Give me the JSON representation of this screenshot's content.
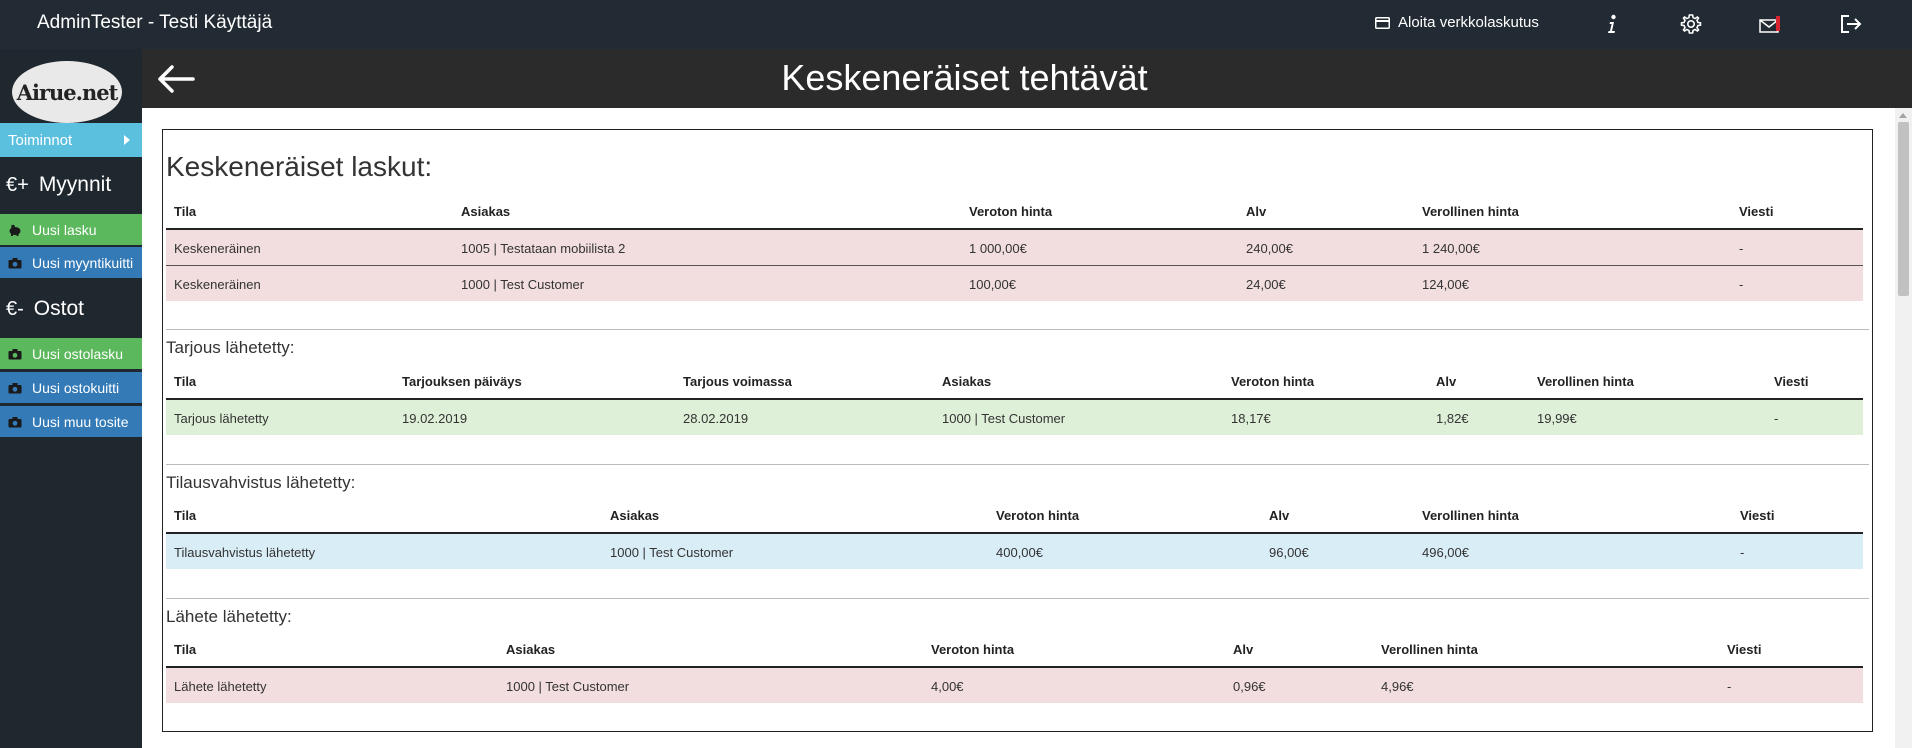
{
  "topbar": {
    "user": "AdminTester - Testi Käyttäjä",
    "einvoice_label": "Aloita verkkolaskutus",
    "icons": [
      "info-icon",
      "gear-icon",
      "mail-icon",
      "logout-icon"
    ]
  },
  "sidebar": {
    "logo": "Airue.net",
    "menu_label": "Toiminnot",
    "sales": {
      "heading_symbol": "€+",
      "heading": "Myynnit",
      "items": [
        {
          "label": "Uusi lasku",
          "color": "#5cb85c",
          "icon": "piggy-bank-icon"
        },
        {
          "label": "Uusi myyntikuitti",
          "color": "#337ab7",
          "icon": "camera-icon"
        }
      ]
    },
    "purchases": {
      "heading_symbol": "€-",
      "heading": "Ostot",
      "items": [
        {
          "label": "Uusi ostolasku",
          "color": "#5cb85c",
          "icon": "camera-icon"
        },
        {
          "label": "Uusi ostokuitti",
          "color": "#337ab7",
          "icon": "camera-icon"
        },
        {
          "label": "Uusi muu tosite",
          "color": "#337ab7",
          "icon": "camera-icon"
        }
      ]
    }
  },
  "header": {
    "title": "Keskeneräiset tehtävät"
  },
  "sections": {
    "invoices": {
      "title": "Keskeneräiset laskut:",
      "columns": [
        "Tila",
        "Asiakas",
        "Veroton hinta",
        "Alv",
        "Verollinen hinta",
        "Viesti"
      ],
      "rows": [
        [
          "Keskeneräinen",
          "1005 | Testataan mobiilista 2",
          "1 000,00€",
          "240,00€",
          "1 240,00€",
          "-"
        ],
        [
          "Keskeneräinen",
          "1000 | Test Customer",
          "100,00€",
          "24,00€",
          "124,00€",
          "-"
        ]
      ]
    },
    "offers": {
      "title": "Tarjous lähetetty:",
      "columns": [
        "Tila",
        "Tarjouksen päiväys",
        "Tarjous voimassa",
        "Asiakas",
        "Veroton hinta",
        "Alv",
        "Verollinen hinta",
        "Viesti"
      ],
      "rows": [
        [
          "Tarjous lähetetty",
          "19.02.2019",
          "28.02.2019",
          "1000 | Test Customer",
          "18,17€",
          "1,82€",
          "19,99€",
          "-"
        ]
      ]
    },
    "confirmations": {
      "title": "Tilausvahvistus lähetetty:",
      "columns": [
        "Tila",
        "Asiakas",
        "Veroton hinta",
        "Alv",
        "Verollinen hinta",
        "Viesti"
      ],
      "rows": [
        [
          "Tilausvahvistus lähetetty",
          "1000 | Test Customer",
          "400,00€",
          "96,00€",
          "496,00€",
          "-"
        ]
      ]
    },
    "deliveries": {
      "title": "Lähete lähetetty:",
      "columns": [
        "Tila",
        "Asiakas",
        "Veroton hinta",
        "Alv",
        "Verollinen hinta",
        "Viesti"
      ],
      "rows": [
        [
          "Lähete lähetetty",
          "1000 | Test Customer",
          "4,00€",
          "0,96€",
          "4,96€",
          "-"
        ]
      ]
    }
  }
}
